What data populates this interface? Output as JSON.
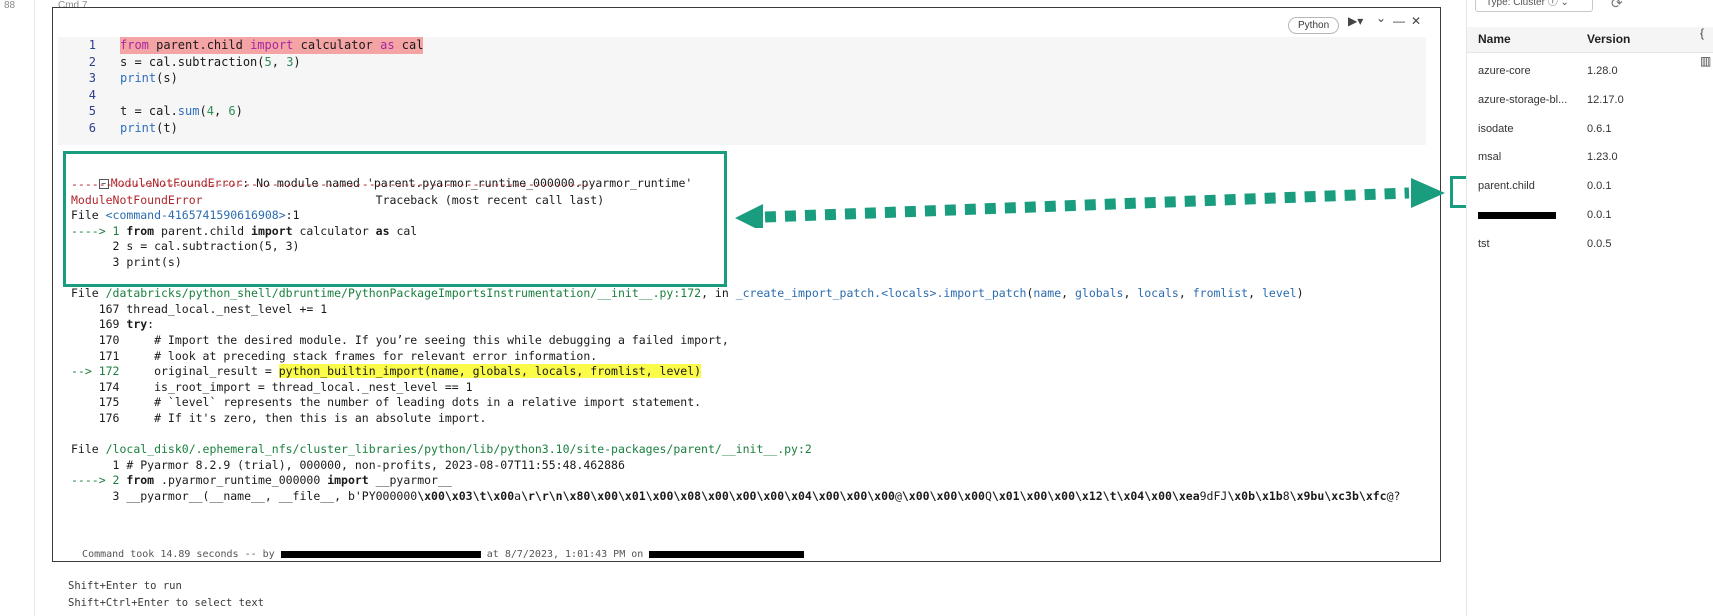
{
  "gutter": {
    "label": "88"
  },
  "cell": {
    "label": "Cmd 7",
    "language": "Python",
    "toolbar": {
      "run_icon": "▶▾",
      "chevron_icon": "⌄",
      "minimize_icon": "—",
      "close_icon": "✕"
    },
    "code_lines": [
      {
        "n": "1",
        "parts": [
          {
            "t": "from",
            "c": "kw"
          },
          {
            "t": " parent.child ",
            "c": ""
          },
          {
            "t": "import",
            "c": "kw"
          },
          {
            "t": " calculator ",
            "c": ""
          },
          {
            "t": "as",
            "c": "kw"
          },
          {
            "t": " cal",
            "c": ""
          }
        ],
        "highlight": true
      },
      {
        "n": "2",
        "parts": [
          {
            "t": "s = cal.subtraction(",
            "c": ""
          },
          {
            "t": "5",
            "c": "num"
          },
          {
            "t": ", ",
            "c": ""
          },
          {
            "t": "3",
            "c": "num"
          },
          {
            "t": ")",
            "c": ""
          }
        ]
      },
      {
        "n": "3",
        "parts": [
          {
            "t": "print",
            "c": "fn"
          },
          {
            "t": "(s)",
            "c": ""
          }
        ]
      },
      {
        "n": "4",
        "parts": []
      },
      {
        "n": "5",
        "parts": [
          {
            "t": "t = cal.",
            "c": ""
          },
          {
            "t": "sum",
            "c": "fn"
          },
          {
            "t": "(",
            "c": ""
          },
          {
            "t": "4",
            "c": "num"
          },
          {
            "t": ", ",
            "c": ""
          },
          {
            "t": "6",
            "c": "num"
          },
          {
            "t": ")",
            "c": ""
          }
        ]
      },
      {
        "n": "6",
        "parts": [
          {
            "t": "print",
            "c": "fn"
          },
          {
            "t": "(t)",
            "c": ""
          }
        ]
      }
    ],
    "output": {
      "error_header": "ModuleNotFoundError",
      "error_message": ": No module named 'parent.pyarmor_runtime_000000.pyarmor_runtime'",
      "lines": [
        [
          {
            "t": "---------------------------------------------------------------------------",
            "c": "err"
          }
        ],
        [
          {
            "t": "ModuleNotFoundError",
            "c": "err"
          },
          {
            "t": "                         Traceback (most recent call last)",
            "c": ""
          }
        ],
        [
          {
            "t": "File ",
            "c": ""
          },
          {
            "t": "<command-4165741590616908>",
            "c": "blu"
          },
          {
            "t": ":1",
            "c": ""
          }
        ],
        [
          {
            "t": "----> 1 ",
            "c": "grn"
          },
          {
            "t": "from",
            "c": "bold"
          },
          {
            "t": " parent.child ",
            "c": ""
          },
          {
            "t": "import",
            "c": "bold"
          },
          {
            "t": " calculator ",
            "c": ""
          },
          {
            "t": "as",
            "c": "bold"
          },
          {
            "t": " cal",
            "c": ""
          }
        ],
        [
          {
            "t": "      2 s = cal.subtraction(5, 3)",
            "c": ""
          }
        ],
        [
          {
            "t": "      3 print(s)",
            "c": ""
          }
        ],
        [
          {
            "t": "",
            "c": ""
          }
        ],
        [
          {
            "t": "File ",
            "c": ""
          },
          {
            "t": "/databricks/python_shell/dbruntime/PythonPackageImportsInstrumentation/__init__.py:172",
            "c": "grn"
          },
          {
            "t": ", in ",
            "c": ""
          },
          {
            "t": "_create_import_patch.<locals>.import_patch",
            "c": "blu"
          },
          {
            "t": "(",
            "c": ""
          },
          {
            "t": "name",
            "c": "blu"
          },
          {
            "t": ", ",
            "c": ""
          },
          {
            "t": "globals",
            "c": "blu"
          },
          {
            "t": ", ",
            "c": ""
          },
          {
            "t": "locals",
            "c": "blu"
          },
          {
            "t": ", ",
            "c": ""
          },
          {
            "t": "fromlist",
            "c": "blu"
          },
          {
            "t": ", ",
            "c": ""
          },
          {
            "t": "level",
            "c": "blu"
          },
          {
            "t": ")",
            "c": ""
          }
        ],
        [
          {
            "t": "    167 thread_local._nest_level += 1",
            "c": ""
          }
        ],
        [
          {
            "t": "    169 ",
            "c": ""
          },
          {
            "t": "try",
            "c": "bold"
          },
          {
            "t": ":",
            "c": ""
          }
        ],
        [
          {
            "t": "    170     # Import the desired module. If you’re seeing this while debugging a failed import,",
            "c": ""
          }
        ],
        [
          {
            "t": "    171     # look at preceding stack frames for relevant error information.",
            "c": ""
          }
        ],
        [
          {
            "t": "--> 172     ",
            "c": "grn"
          },
          {
            "t": "original_result = ",
            "c": ""
          },
          {
            "t": "python_builtin_import(name, globals, locals, fromlist, level)",
            "c": "hl-yel"
          }
        ],
        [
          {
            "t": "    174     is_root_import = thread_local._nest_level == 1",
            "c": ""
          }
        ],
        [
          {
            "t": "    175     # `level` represents the number of leading dots in a relative import statement.",
            "c": ""
          }
        ],
        [
          {
            "t": "    176     # If it's zero, then this is an absolute import.",
            "c": ""
          }
        ],
        [
          {
            "t": "",
            "c": ""
          }
        ],
        [
          {
            "t": "File ",
            "c": ""
          },
          {
            "t": "/local_disk0/.ephemeral_nfs/cluster_libraries/python/lib/python3.10/site-packages/parent/__init__.py:2",
            "c": "grn"
          }
        ],
        [
          {
            "t": "      1 # Pyarmor 8.2.9 (trial), 000000, non-profits, 2023-08-07T11:55:48.462886",
            "c": ""
          }
        ],
        [
          {
            "t": "----> 2 ",
            "c": "grn"
          },
          {
            "t": "from",
            "c": "bold"
          },
          {
            "t": " .pyarmor_runtime_000000 ",
            "c": ""
          },
          {
            "t": "import",
            "c": "bold"
          },
          {
            "t": " __pyarmor__",
            "c": ""
          }
        ],
        [
          {
            "t": "      3 __pyarmor__(__name__, __file__, b'PY000000",
            "c": ""
          },
          {
            "t": "\\x00\\x03\\t\\x00",
            "c": "bold"
          },
          {
            "t": "a",
            "c": ""
          },
          {
            "t": "\\r\\r\\n\\x80\\x00\\x01\\x00\\x08\\x00\\x00\\x00\\x04\\x00\\x00\\x00",
            "c": "bold"
          },
          {
            "t": "@",
            "c": ""
          },
          {
            "t": "\\x00\\x00\\x00",
            "c": "bold"
          },
          {
            "t": "Q",
            "c": ""
          },
          {
            "t": "\\x01\\x00\\x00\\x12\\t\\x04\\x00\\xea",
            "c": "bold"
          },
          {
            "t": "9dFJ",
            "c": ""
          },
          {
            "t": "\\x0b\\x1b",
            "c": "bold"
          },
          {
            "t": "8",
            "c": ""
          },
          {
            "t": "\\x9bu\\xc3b\\xfc",
            "c": "bold"
          },
          {
            "t": "@?",
            "c": ""
          }
        ]
      ],
      "status_prefix": "Command took 14.89 seconds -- by ",
      "status_mid": " at 8/7/2023, 1:01:43 PM on "
    },
    "hints": [
      "Shift+Enter to run",
      "Shift+Ctrl+Enter to select text"
    ]
  },
  "right_panel": {
    "cluster_select": "Type: Cluster",
    "refresh_icon": "refresh-icon",
    "columns": {
      "name": "Name",
      "version": "Version"
    },
    "packages": [
      {
        "name": "azure-core",
        "version": "1.28.0"
      },
      {
        "name": "azure-storage-bl...",
        "version": "12.17.0"
      },
      {
        "name": "isodate",
        "version": "0.6.1"
      },
      {
        "name": "msal",
        "version": "1.23.0"
      },
      {
        "name": "parent.child",
        "version": "0.0.1"
      },
      {
        "name": "",
        "version": "0.0.1",
        "redacted": true
      },
      {
        "name": "tst",
        "version": "0.0.5"
      }
    ]
  },
  "colors": {
    "annotation": "#1a9d7e",
    "error": "#b0262c",
    "highlight_yellow": "#fbfb4a",
    "highlight_red": "#f4a4a4"
  }
}
